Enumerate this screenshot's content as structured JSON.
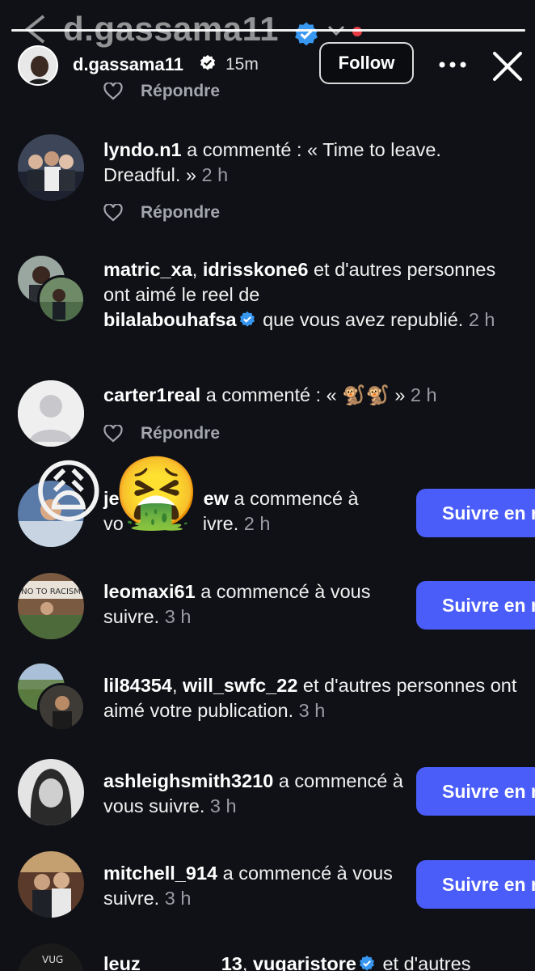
{
  "background_header": {
    "title": "d.gassama11"
  },
  "story": {
    "progress": 1.0,
    "owner": "d.gassama11",
    "time": "15m",
    "follow_label": "Follow"
  },
  "reply_label": "Répondre",
  "notifications": [
    {
      "user": "lyndo.n1",
      "action": "a commenté : « Time to leave. Dreadful. »",
      "time": "2 h"
    },
    {
      "user": "matric_xa",
      "user2": "idrisskone6",
      "action": "et d'autres personnes ont aimé le reel de",
      "user3": "bilalabouhafsa",
      "action2": "que vous avez republié.",
      "time": "2 h"
    },
    {
      "user": "carter1real",
      "action": "a commenté : «",
      "emoji": "🐒🐒",
      "action2": "»",
      "time": "2 h"
    },
    {
      "user": "je",
      "user_tail": "ew",
      "action": "a commencé à",
      "action_line2_pre": "vo",
      "action_line2_post": "ivre.",
      "time": "2 h",
      "button": "Suivre en retour"
    },
    {
      "user": "leomaxi61",
      "action": "a commencé à vous suivre.",
      "time": "3 h",
      "button": "Suivre en retour"
    },
    {
      "user": "lil84354",
      "user2": "will_swfc_22",
      "action": "et d'autres personnes ont aimé votre publication.",
      "time": "3 h"
    },
    {
      "user": "ashleighsmith3210",
      "action": "a commencé à vous suivre.",
      "time": "3 h",
      "button": "Suivre en retour"
    },
    {
      "user": "mitchell_914",
      "action": "a commencé à vous suivre.",
      "time": "3 h",
      "button": "Suivre en retour"
    },
    {
      "user": "leuz",
      "user_tail": "13",
      "user2": "vugaristore",
      "action": "et d'autres"
    }
  ],
  "overlay_emojis": [
    "😩",
    "🤮"
  ],
  "colors": {
    "background": "#0f1116",
    "accent": "#4a5df9",
    "verified": "#3897f0",
    "live_dot": "#e63b45"
  }
}
